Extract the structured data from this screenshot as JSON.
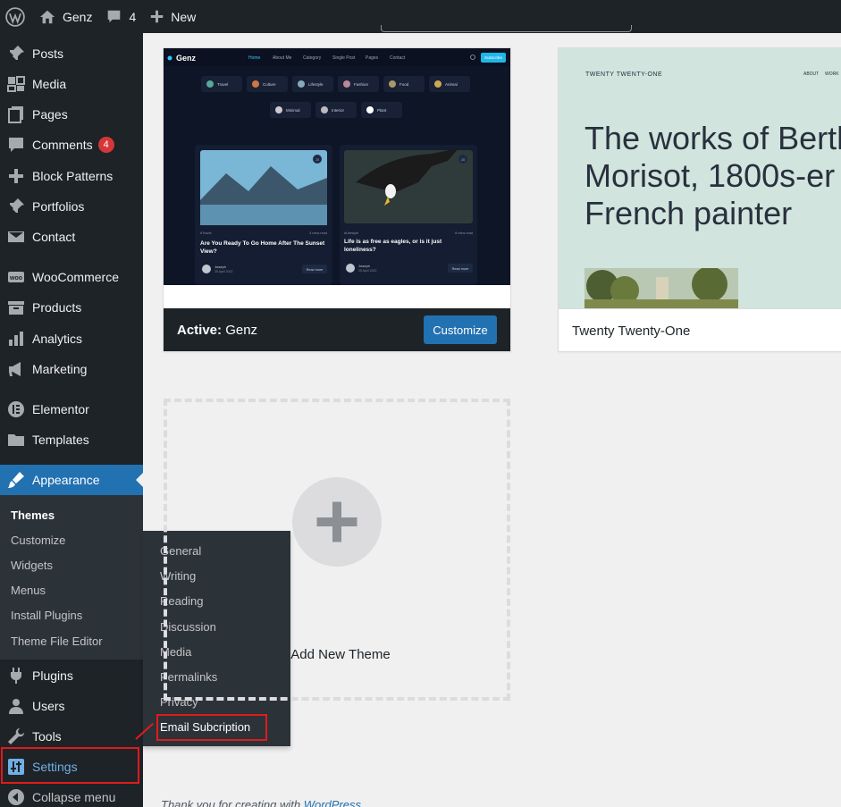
{
  "admin_bar": {
    "site_name": "Genz",
    "comments_count": "4",
    "new_label": "New"
  },
  "sidebar": {
    "items": [
      {
        "label": "Posts",
        "icon": "pin-icon"
      },
      {
        "label": "Media",
        "icon": "media-icon"
      },
      {
        "label": "Pages",
        "icon": "pages-icon"
      },
      {
        "label": "Comments",
        "icon": "comment-icon",
        "badge": "4"
      },
      {
        "label": "Block Patterns",
        "icon": "plus-icon"
      },
      {
        "label": "Portfolios",
        "icon": "pin-icon"
      },
      {
        "label": "Contact",
        "icon": "mail-icon"
      },
      {
        "label": "WooCommerce",
        "icon": "woo-icon"
      },
      {
        "label": "Products",
        "icon": "archive-icon"
      },
      {
        "label": "Analytics",
        "icon": "bar-chart-icon"
      },
      {
        "label": "Marketing",
        "icon": "megaphone-icon"
      },
      {
        "label": "Elementor",
        "icon": "elementor-icon"
      },
      {
        "label": "Templates",
        "icon": "folder-icon"
      },
      {
        "label": "Appearance",
        "icon": "brush-icon"
      },
      {
        "label": "Plugins",
        "icon": "plug-icon"
      },
      {
        "label": "Users",
        "icon": "user-icon"
      },
      {
        "label": "Tools",
        "icon": "wrench-icon"
      },
      {
        "label": "Settings",
        "icon": "sliders-icon"
      },
      {
        "label": "Collapse menu",
        "icon": "collapse-icon"
      }
    ],
    "appearance_submenu": [
      "Themes",
      "Customize",
      "Widgets",
      "Menus",
      "Install Plugins",
      "Theme File Editor"
    ]
  },
  "settings_flyout": [
    "General",
    "Writing",
    "Reading",
    "Discussion",
    "Media",
    "Permalinks",
    "Privacy",
    "Email Subcription"
  ],
  "themes": {
    "active": {
      "prefix": "Active:",
      "name": "Genz",
      "customize_label": "Customize",
      "preview": {
        "logo": "Genz",
        "nav": [
          "Home",
          "About Me",
          "Category",
          "Single Post",
          "Pages",
          "Contact"
        ],
        "subscribe": "Subscribe",
        "chips_row1": [
          "Travel",
          "Culture",
          "Lifestyle",
          "Fashion",
          "Food",
          "Animal"
        ],
        "chips_row2": [
          "Minimal",
          "Interior",
          "Plant"
        ],
        "posts": [
          {
            "tag": "#Travel",
            "read": "3 mins read",
            "title": "Are You Ready To Go Home After The Sunset View?",
            "author": "Joseph",
            "date": "25 April 2022",
            "more": "Read more",
            "num": "28"
          },
          {
            "tag": "#Lifestyle",
            "read": "8 mins read",
            "title": "Life is as free as eagles, or is it just loneliness?",
            "author": "Joseph",
            "date": "25 April 2022",
            "more": "Read more",
            "num": "28"
          }
        ]
      }
    },
    "second": {
      "name": "Twenty Twenty-One",
      "preview": {
        "site_title": "TWENTY TWENTY-ONE",
        "nav": [
          "ABOUT",
          "WORK"
        ],
        "headline_1": "The works of Berth",
        "headline_2": "Morisot, 1800s-er",
        "headline_3": "French painter"
      }
    },
    "add_new_label": "Add New Theme"
  },
  "footer": {
    "prefix": "Thank you for creating with",
    "link": "WordPress"
  }
}
